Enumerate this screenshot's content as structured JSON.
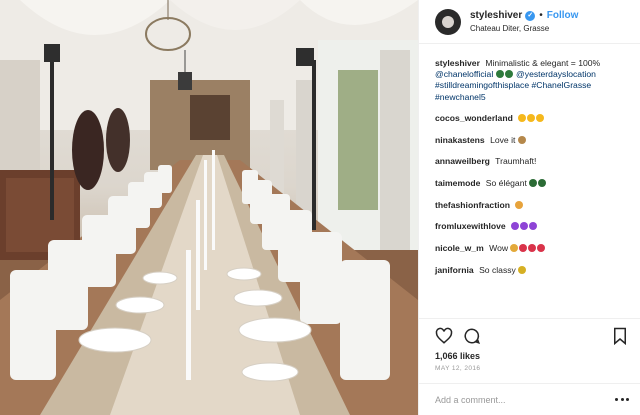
{
  "post": {
    "username": "styleshiver",
    "verified_mark": "✓",
    "dot": "•",
    "follow_label": "Follow",
    "location": "Chateau Diter, Grasse",
    "caption": {
      "username": "styleshiver",
      "text": "Minimalistic & elegant = 100%",
      "mention": "@chanelofficial",
      "tag1": "@yesterdayslocation",
      "tag2": "#stilldreamingofthisplace",
      "tag3": "#ChanelGrasse",
      "tag4": "#newchanel5"
    },
    "comments": [
      {
        "username": "cocos_wonderland",
        "text": "",
        "emojis": [
          "#f5b81c",
          "#f5b81c",
          "#f5b81c"
        ]
      },
      {
        "username": "ninakastens",
        "text": "Love it",
        "emojis": [
          "#b5884b"
        ]
      },
      {
        "username": "annaweilberg",
        "text": "Traumhaft!",
        "emojis": []
      },
      {
        "username": "taimemode",
        "text": "So élégant",
        "emojis": [
          "#2b6b35",
          "#2b6b35"
        ]
      },
      {
        "username": "thefashionfraction",
        "text": "",
        "emojis": [
          "#e7a33b"
        ]
      },
      {
        "username": "fromluxewithlove",
        "text": "",
        "emojis": [
          "#8e44d6",
          "#8e44d6",
          "#8e44d6"
        ]
      },
      {
        "username": "nicole_w_m",
        "text": "Wow",
        "emojis": [
          "#e3a93a",
          "#d9334a",
          "#d9334a",
          "#d9334a"
        ]
      },
      {
        "username": "janifornia",
        "text": "So classy",
        "emojis": [
          "#d6b024"
        ]
      }
    ],
    "likes": "1,066 likes",
    "date": "MAY 12, 2016",
    "add_comment_placeholder": "Add a comment..."
  },
  "icons": {
    "heart": "heart-icon",
    "comment": "comment-icon",
    "bookmark": "bookmark-icon",
    "more": "more-options-icon",
    "verified": "verified-badge-icon"
  },
  "colors": {
    "link": "#003569",
    "follow": "#3897f0",
    "border": "#efefef",
    "muted": "#999999"
  }
}
